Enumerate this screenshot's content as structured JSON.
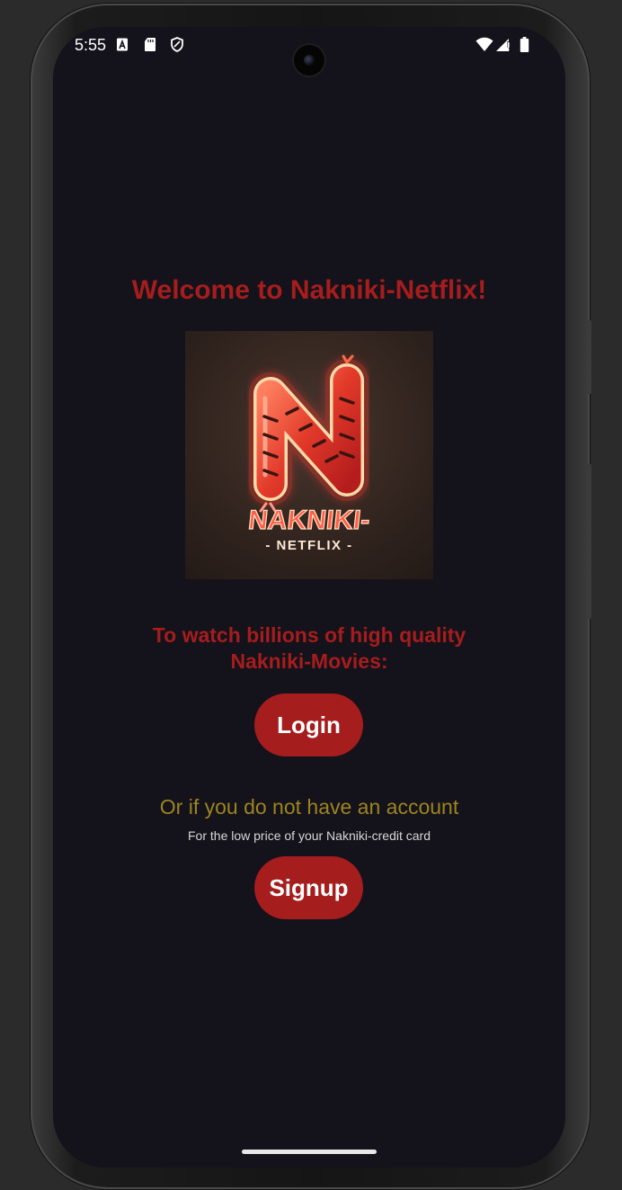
{
  "status_bar": {
    "time": "5:55",
    "icons": [
      "a-notification-icon",
      "sd-card-icon",
      "shield-icon",
      "wifi-icon",
      "signal-icon",
      "battery-icon"
    ]
  },
  "app": {
    "title": "Welcome to Nakniki-Netflix!",
    "logo": {
      "brand_text": "NAKNIKI-",
      "brand_sub": "- NETFLIX -",
      "letter": "N"
    },
    "subtitle_line1": "To watch billions of high quality",
    "subtitle_line2": "Nakniki-Movies:",
    "login_label": "Login",
    "account_prompt": "Or if you do not have an account",
    "price_note": "For the low price of your Nakniki-credit card",
    "signup_label": "Signup"
  },
  "colors": {
    "accent": "#a51d1d",
    "background": "#14121a",
    "gold_text": "#9c8520"
  }
}
